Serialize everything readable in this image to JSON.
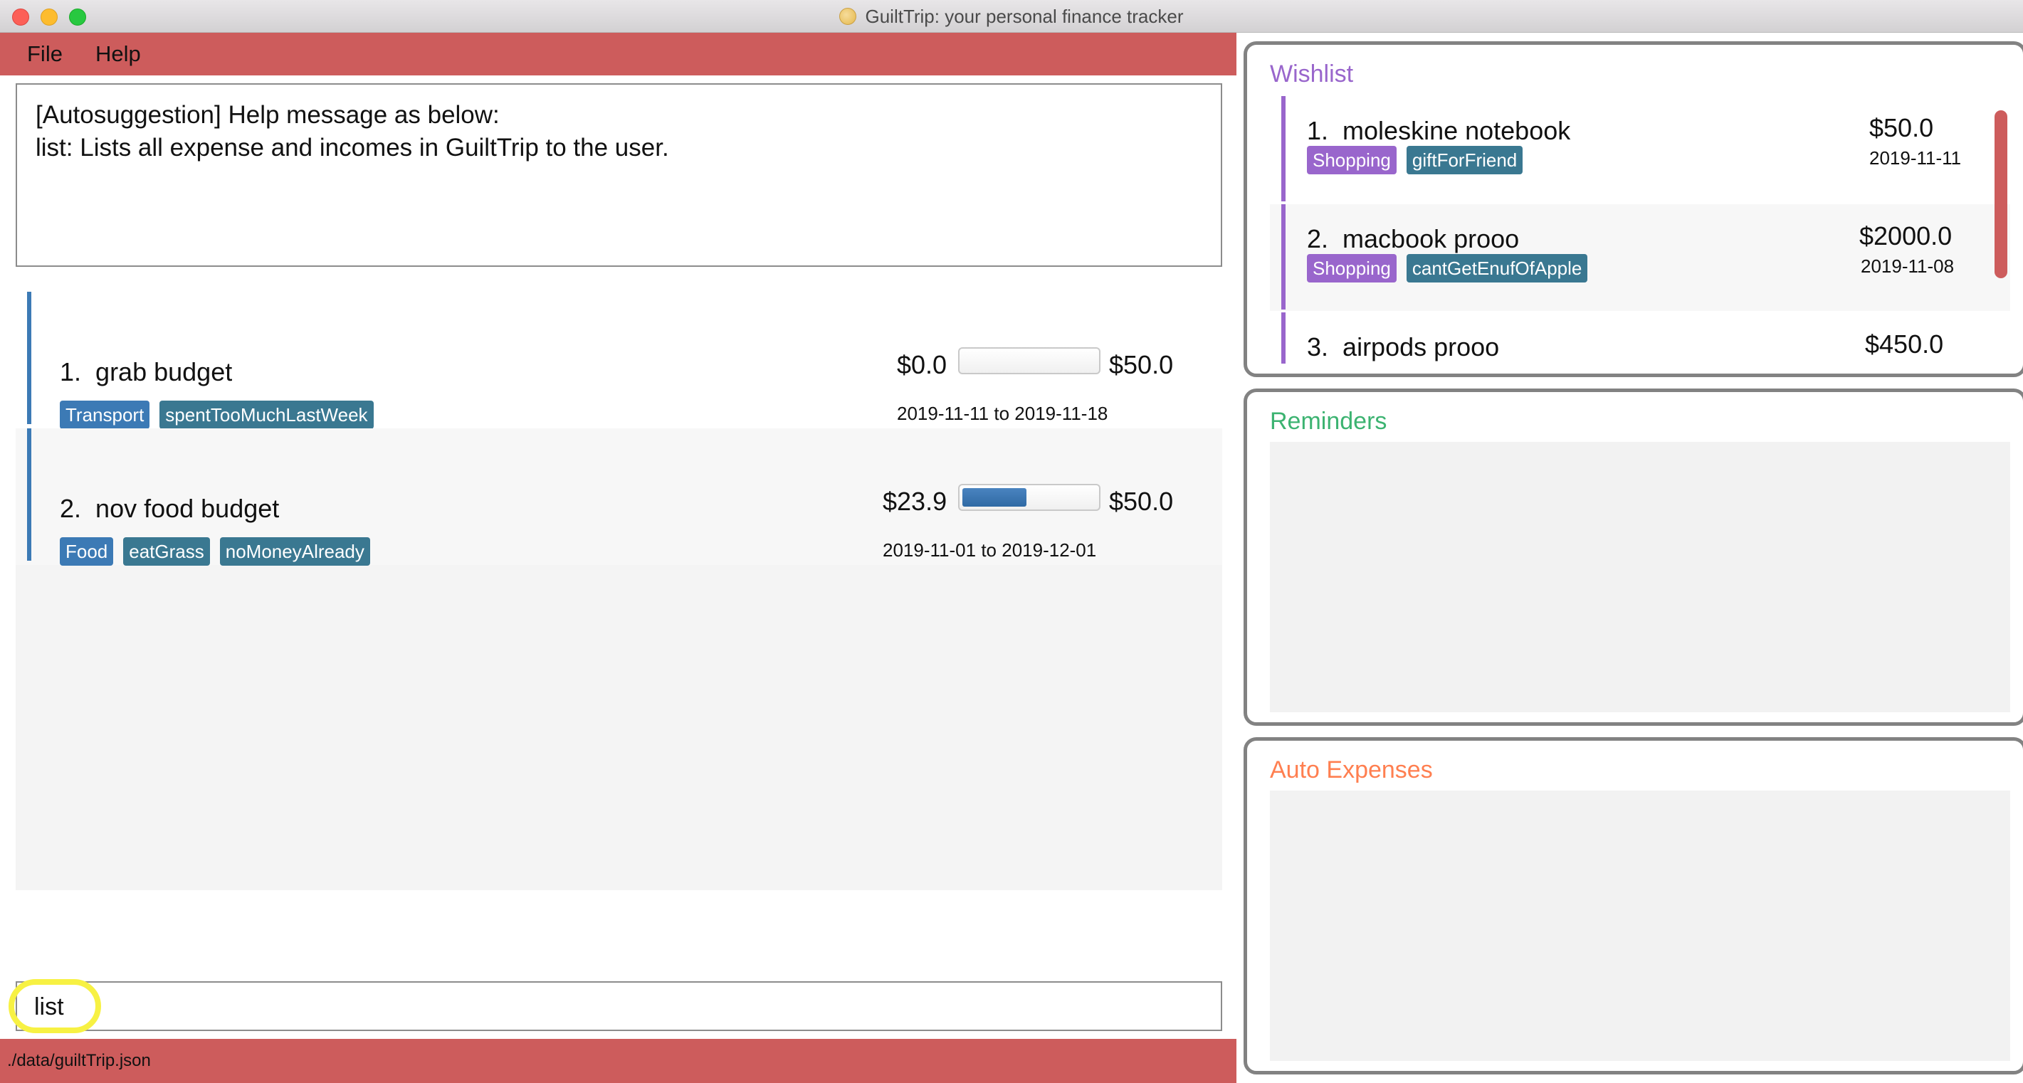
{
  "window": {
    "title": "GuiltTrip: your personal finance tracker"
  },
  "menu": {
    "file": "File",
    "help": "Help"
  },
  "result": {
    "line1": "[Autosuggestion] Help message as below:",
    "line2": "list: Lists all expense and incomes in GuiltTrip to the user."
  },
  "budgets": [
    {
      "index": "1.",
      "name": "grab budget",
      "spent": "$0.0",
      "limit": "$50.0",
      "progress": 0.0,
      "tags": [
        "Transport",
        "spentTooMuchLastWeek"
      ],
      "start": "2019-11-11",
      "to": "to",
      "end": "2019-11-18"
    },
    {
      "index": "2.",
      "name": "nov food budget",
      "spent": "$23.9",
      "limit": "$50.0",
      "progress": 0.478,
      "tags": [
        "Food",
        "eatGrass",
        "noMoneyAlready"
      ],
      "start": "2019-11-01",
      "to": "to",
      "end": "2019-12-01"
    }
  ],
  "command": {
    "value": "list"
  },
  "status": {
    "path": "./data/guiltTrip.json"
  },
  "wishlist": {
    "title": "Wishlist",
    "items": [
      {
        "index": "1.",
        "name": "moleskine notebook",
        "amount": "$50.0",
        "date": "2019-11-11",
        "tags": [
          "Shopping",
          "giftForFriend"
        ]
      },
      {
        "index": "2.",
        "name": "macbook prooo",
        "amount": "$2000.0",
        "date": "2019-11-08",
        "tags": [
          "Shopping",
          "cantGetEnufOfApple"
        ]
      },
      {
        "index": "3.",
        "name": "airpods prooo",
        "amount": "$450.0"
      }
    ]
  },
  "reminders": {
    "title": "Reminders"
  },
  "auto_expenses": {
    "title": "Auto Expenses"
  },
  "colors": {
    "accent_red": "#cd5c5c",
    "budget_blue": "#3c7ab5",
    "tag_teal": "#3a7891",
    "wishlist_purple": "#9966cc",
    "reminders_green": "#3cb371",
    "auto_expenses_orange": "#ff7f50",
    "highlight_yellow": "#f7f143"
  },
  "icons": {
    "app": "coin-icon"
  }
}
